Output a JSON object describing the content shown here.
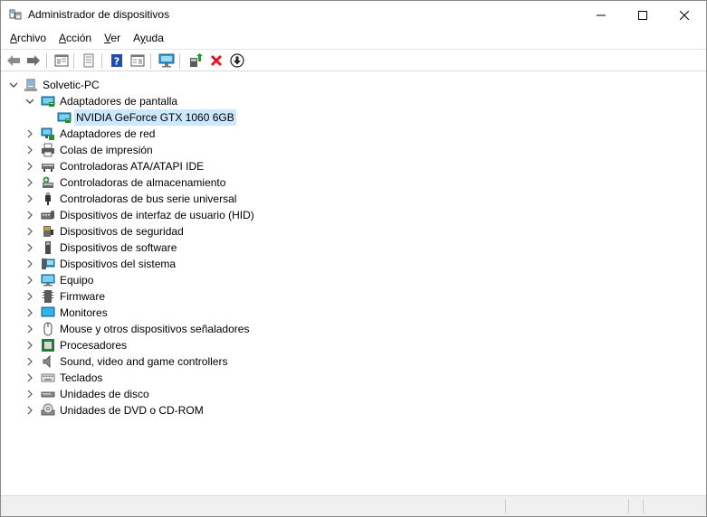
{
  "window": {
    "title": "Administrador de dispositivos"
  },
  "menu": [
    {
      "label": "Archivo",
      "accel": "A",
      "rest": "rchivo"
    },
    {
      "label": "Acción",
      "accel": "A",
      "rest": "cción"
    },
    {
      "label": "Ver",
      "accel": "V",
      "rest": "er"
    },
    {
      "label": "Ayuda",
      "accel": "y",
      "pre": "A",
      "rest": "uda"
    }
  ],
  "toolbar": [
    "back-arrow-icon",
    "forward-arrow-icon",
    "show-hide-console-tree-icon",
    "properties-icon",
    "help-icon",
    "action-pane-icon",
    "scan-hardware-icon",
    "update-driver-icon",
    "uninstall-device-icon",
    "disable-device-icon"
  ],
  "tree": {
    "root": "Solvetic-PC",
    "items": [
      {
        "label": "Adaptadores de pantalla",
        "expanded": true,
        "icon": "display-adapter-icon",
        "children": [
          {
            "label": "NVIDIA GeForce GTX 1060 6GB",
            "selected": true,
            "icon": "display-adapter-icon"
          }
        ]
      },
      {
        "label": "Adaptadores de red",
        "icon": "network-adapter-icon"
      },
      {
        "label": "Colas de impresión",
        "icon": "printer-icon"
      },
      {
        "label": "Controladoras ATA/ATAPI IDE",
        "icon": "ide-controller-icon"
      },
      {
        "label": "Controladoras de almacenamiento",
        "icon": "storage-controller-icon"
      },
      {
        "label": "Controladoras de bus serie universal",
        "icon": "usb-icon"
      },
      {
        "label": "Dispositivos de interfaz de usuario (HID)",
        "icon": "hid-icon"
      },
      {
        "label": "Dispositivos de seguridad",
        "icon": "security-device-icon"
      },
      {
        "label": "Dispositivos de software",
        "icon": "software-device-icon"
      },
      {
        "label": "Dispositivos del sistema",
        "icon": "system-device-icon"
      },
      {
        "label": "Equipo",
        "icon": "computer-icon"
      },
      {
        "label": "Firmware",
        "icon": "firmware-icon"
      },
      {
        "label": "Monitores",
        "icon": "monitor-icon"
      },
      {
        "label": "Mouse y otros dispositivos señaladores",
        "icon": "mouse-icon"
      },
      {
        "label": "Procesadores",
        "icon": "processor-icon"
      },
      {
        "label": "Sound, video and game controllers",
        "icon": "sound-icon"
      },
      {
        "label": "Teclados",
        "icon": "keyboard-icon"
      },
      {
        "label": "Unidades de disco",
        "icon": "disk-drive-icon"
      },
      {
        "label": "Unidades de DVD o CD-ROM",
        "icon": "dvd-drive-icon"
      }
    ]
  },
  "colors": {
    "selection": "#cce8ff",
    "uninstall_red": "#e81123",
    "monitor_teal": "#1e9fd8",
    "help_blue": "#1c4fb5"
  }
}
